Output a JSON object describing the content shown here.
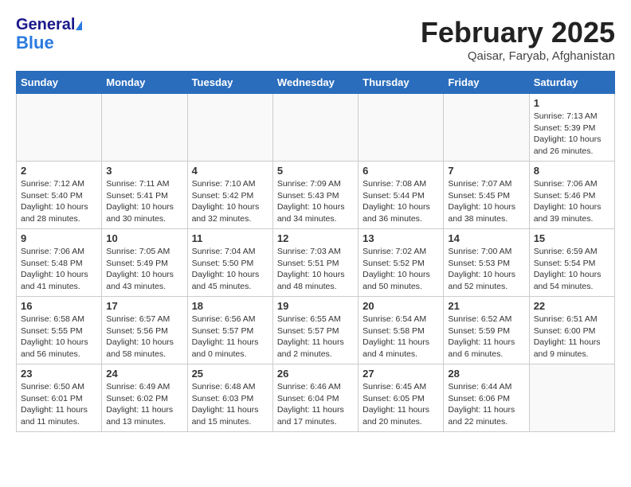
{
  "header": {
    "logo_general": "General",
    "logo_blue": "Blue",
    "month_title": "February 2025",
    "location": "Qaisar, Faryab, Afghanistan"
  },
  "days_of_week": [
    "Sunday",
    "Monday",
    "Tuesday",
    "Wednesday",
    "Thursday",
    "Friday",
    "Saturday"
  ],
  "weeks": [
    [
      {
        "day": "",
        "info": ""
      },
      {
        "day": "",
        "info": ""
      },
      {
        "day": "",
        "info": ""
      },
      {
        "day": "",
        "info": ""
      },
      {
        "day": "",
        "info": ""
      },
      {
        "day": "",
        "info": ""
      },
      {
        "day": "1",
        "info": "Sunrise: 7:13 AM\nSunset: 5:39 PM\nDaylight: 10 hours and 26 minutes."
      }
    ],
    [
      {
        "day": "2",
        "info": "Sunrise: 7:12 AM\nSunset: 5:40 PM\nDaylight: 10 hours and 28 minutes."
      },
      {
        "day": "3",
        "info": "Sunrise: 7:11 AM\nSunset: 5:41 PM\nDaylight: 10 hours and 30 minutes."
      },
      {
        "day": "4",
        "info": "Sunrise: 7:10 AM\nSunset: 5:42 PM\nDaylight: 10 hours and 32 minutes."
      },
      {
        "day": "5",
        "info": "Sunrise: 7:09 AM\nSunset: 5:43 PM\nDaylight: 10 hours and 34 minutes."
      },
      {
        "day": "6",
        "info": "Sunrise: 7:08 AM\nSunset: 5:44 PM\nDaylight: 10 hours and 36 minutes."
      },
      {
        "day": "7",
        "info": "Sunrise: 7:07 AM\nSunset: 5:45 PM\nDaylight: 10 hours and 38 minutes."
      },
      {
        "day": "8",
        "info": "Sunrise: 7:06 AM\nSunset: 5:46 PM\nDaylight: 10 hours and 39 minutes."
      }
    ],
    [
      {
        "day": "9",
        "info": "Sunrise: 7:06 AM\nSunset: 5:48 PM\nDaylight: 10 hours and 41 minutes."
      },
      {
        "day": "10",
        "info": "Sunrise: 7:05 AM\nSunset: 5:49 PM\nDaylight: 10 hours and 43 minutes."
      },
      {
        "day": "11",
        "info": "Sunrise: 7:04 AM\nSunset: 5:50 PM\nDaylight: 10 hours and 45 minutes."
      },
      {
        "day": "12",
        "info": "Sunrise: 7:03 AM\nSunset: 5:51 PM\nDaylight: 10 hours and 48 minutes."
      },
      {
        "day": "13",
        "info": "Sunrise: 7:02 AM\nSunset: 5:52 PM\nDaylight: 10 hours and 50 minutes."
      },
      {
        "day": "14",
        "info": "Sunrise: 7:00 AM\nSunset: 5:53 PM\nDaylight: 10 hours and 52 minutes."
      },
      {
        "day": "15",
        "info": "Sunrise: 6:59 AM\nSunset: 5:54 PM\nDaylight: 10 hours and 54 minutes."
      }
    ],
    [
      {
        "day": "16",
        "info": "Sunrise: 6:58 AM\nSunset: 5:55 PM\nDaylight: 10 hours and 56 minutes."
      },
      {
        "day": "17",
        "info": "Sunrise: 6:57 AM\nSunset: 5:56 PM\nDaylight: 10 hours and 58 minutes."
      },
      {
        "day": "18",
        "info": "Sunrise: 6:56 AM\nSunset: 5:57 PM\nDaylight: 11 hours and 0 minutes."
      },
      {
        "day": "19",
        "info": "Sunrise: 6:55 AM\nSunset: 5:57 PM\nDaylight: 11 hours and 2 minutes."
      },
      {
        "day": "20",
        "info": "Sunrise: 6:54 AM\nSunset: 5:58 PM\nDaylight: 11 hours and 4 minutes."
      },
      {
        "day": "21",
        "info": "Sunrise: 6:52 AM\nSunset: 5:59 PM\nDaylight: 11 hours and 6 minutes."
      },
      {
        "day": "22",
        "info": "Sunrise: 6:51 AM\nSunset: 6:00 PM\nDaylight: 11 hours and 9 minutes."
      }
    ],
    [
      {
        "day": "23",
        "info": "Sunrise: 6:50 AM\nSunset: 6:01 PM\nDaylight: 11 hours and 11 minutes."
      },
      {
        "day": "24",
        "info": "Sunrise: 6:49 AM\nSunset: 6:02 PM\nDaylight: 11 hours and 13 minutes."
      },
      {
        "day": "25",
        "info": "Sunrise: 6:48 AM\nSunset: 6:03 PM\nDaylight: 11 hours and 15 minutes."
      },
      {
        "day": "26",
        "info": "Sunrise: 6:46 AM\nSunset: 6:04 PM\nDaylight: 11 hours and 17 minutes."
      },
      {
        "day": "27",
        "info": "Sunrise: 6:45 AM\nSunset: 6:05 PM\nDaylight: 11 hours and 20 minutes."
      },
      {
        "day": "28",
        "info": "Sunrise: 6:44 AM\nSunset: 6:06 PM\nDaylight: 11 hours and 22 minutes."
      },
      {
        "day": "",
        "info": ""
      }
    ]
  ]
}
